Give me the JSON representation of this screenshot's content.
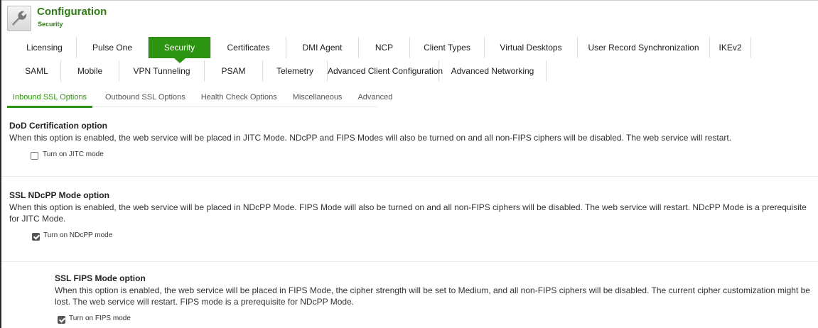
{
  "header": {
    "title": "Configuration",
    "subtitle": "Security",
    "icon": "wrench-icon"
  },
  "tabs_row1": [
    {
      "label": "Licensing"
    },
    {
      "label": "Pulse One"
    },
    {
      "label": "Security",
      "active": true
    },
    {
      "label": "Certificates"
    },
    {
      "label": "DMI Agent"
    },
    {
      "label": "NCP"
    },
    {
      "label": "Client Types"
    },
    {
      "label": "Virtual Desktops"
    },
    {
      "label": "User Record Synchronization"
    },
    {
      "label": "IKEv2"
    }
  ],
  "tabs_row2": [
    {
      "label": "SAML"
    },
    {
      "label": "Mobile"
    },
    {
      "label": "VPN Tunneling"
    },
    {
      "label": "PSAM"
    },
    {
      "label": "Telemetry"
    },
    {
      "label": "Advanced Client Configuration"
    },
    {
      "label": "Advanced Networking"
    }
  ],
  "subtabs": [
    {
      "label": "Inbound SSL Options",
      "active": true
    },
    {
      "label": "Outbound SSL Options"
    },
    {
      "label": "Health Check Options"
    },
    {
      "label": "Miscellaneous"
    },
    {
      "label": "Advanced"
    }
  ],
  "sections": {
    "dod": {
      "title": "DoD Certification option",
      "description": "When this option is enabled, the web service will be placed in JITC Mode. NDcPP and FIPS Modes will also be turned on and all non-FIPS ciphers will be disabled. The web service will restart.",
      "checkbox_label": "Turn on JITC mode",
      "checked": false
    },
    "ndcpp": {
      "title": "SSL NDcPP Mode option",
      "description": "When this option is enabled, the web service will be placed in NDcPP Mode. FIPS Mode will also be turned on and all non-FIPS ciphers will be disabled. The web service will restart. NDcPP Mode is a prerequisite for JITC Mode.",
      "checkbox_label": "Turn on NDcPP mode",
      "checked": true
    },
    "fips": {
      "title": "SSL FIPS Mode option",
      "description": "When this option is enabled, the web service will be placed in FIPS Mode, the cipher strength will be set to Medium, and all non-FIPS ciphers will be disabled. The current cipher customization might be lost. The web service will restart. FIPS mode is a prerequisite for NDcPP Mode.",
      "checkbox_label": "Turn on FIPS mode",
      "checked": true
    }
  },
  "colors": {
    "accent": "#2c9410",
    "title_green": "#2f7d14"
  }
}
